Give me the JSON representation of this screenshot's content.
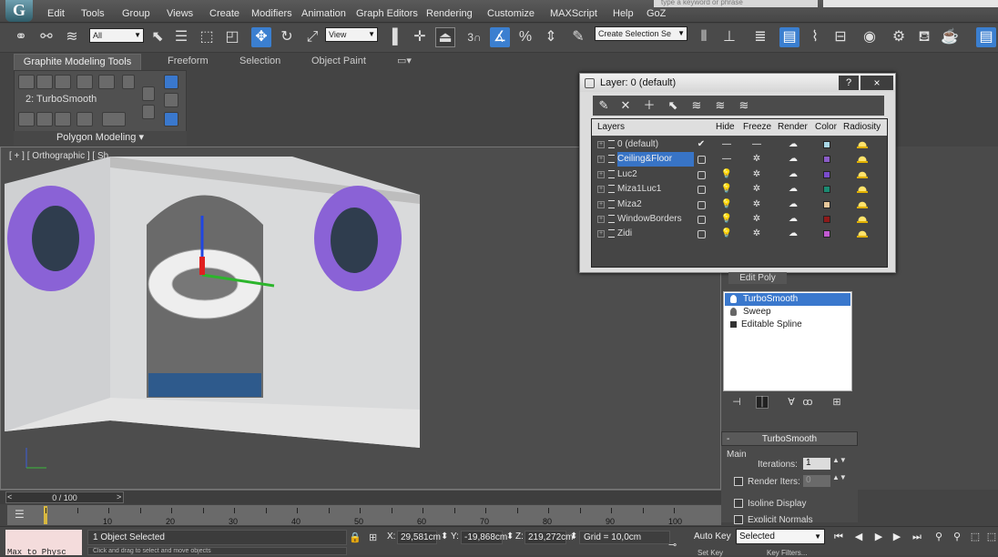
{
  "app": {
    "logo": "G"
  },
  "menu": [
    "Edit",
    "Tools",
    "Group",
    "Views",
    "Create",
    "Modifiers",
    "Animation",
    "Graph Editors",
    "Rendering",
    "Customize",
    "MAXScript",
    "Help",
    "GoZ"
  ],
  "search_placeholder": "type a keyword or phrase",
  "toolbar": {
    "filter_value": "All",
    "view_value": "View",
    "snap_label": "3",
    "named_selection_placeholder": "Create Selection Se"
  },
  "ribbon": {
    "tabs": [
      "Graphite Modeling Tools",
      "Freeform",
      "Selection",
      "Object Paint"
    ],
    "level_label": "2: TurboSmooth",
    "footer_label": "Polygon Modeling"
  },
  "viewport": {
    "label": "[ + ] [ Orthographic ] [ Sh"
  },
  "layer_dialog": {
    "title": "Layer: 0 (default)",
    "help": "?",
    "close": "×",
    "columns": [
      "Layers",
      "Hide",
      "Freeze",
      "Render",
      "Color",
      "Radiosity"
    ],
    "layers": [
      {
        "name": "0 (default)",
        "current": true,
        "hide": "—",
        "freeze": "—",
        "render": "☁",
        "color": "#a9d7e6"
      },
      {
        "name": "Ceiling&Floor",
        "current": false,
        "hide": "—",
        "freeze": "✲",
        "render": "☁",
        "color": "#8a5cc8"
      },
      {
        "name": "Luc2",
        "current": false,
        "hide": "💡",
        "freeze": "✲",
        "render": "☁",
        "color": "#7a4ccd"
      },
      {
        "name": "Miza1Luc1",
        "current": false,
        "hide": "💡",
        "freeze": "✲",
        "render": "☁",
        "color": "#1b8a72"
      },
      {
        "name": "Miza2",
        "current": false,
        "hide": "💡",
        "freeze": "✲",
        "render": "☁",
        "color": "#e6c79b"
      },
      {
        "name": "WindowBorders",
        "current": false,
        "hide": "💡",
        "freeze": "✲",
        "render": "☁",
        "color": "#8e1a1a"
      },
      {
        "name": "Zidi",
        "current": false,
        "hide": "💡",
        "freeze": "✲",
        "render": "☁",
        "color": "#c25ad2"
      }
    ],
    "selected_index": 1
  },
  "modifier_stack": {
    "above_label": "Edit Poly",
    "items": [
      {
        "name": "TurboSmooth",
        "selected": true,
        "icon": "bulb"
      },
      {
        "name": "Sweep",
        "selected": false,
        "icon": "bulb"
      },
      {
        "name": "Editable Spline",
        "selected": false,
        "icon": "box"
      }
    ]
  },
  "turbosmooth": {
    "header": "TurboSmooth",
    "collapse": "-",
    "group": "Main",
    "iterations_label": "Iterations:",
    "iterations_value": "1",
    "render_iters_label": "Render Iters:",
    "render_iters_value": "0",
    "isoline_label": "Isoline Display",
    "explicit_label": "Explicit Normals"
  },
  "timeline": {
    "slider_label": "0 / 100",
    "ticks": [
      "10",
      "20",
      "30",
      "40",
      "50",
      "60",
      "70",
      "80",
      "90",
      "100"
    ]
  },
  "status": {
    "maxscript": "Max to Physc",
    "selection_text": "1 Object Selected",
    "prompt_text": "Click and drag to select and move objects",
    "x_label": "X:",
    "x_value": "29,581cm",
    "y_label": "Y:",
    "y_value": "-19,868cm",
    "z_label": "Z:",
    "z_value": "219,272cm",
    "grid": "Grid = 10,0cm",
    "auto_key": "Auto Key",
    "set_key": "Set Key",
    "key_mode": "Selected",
    "key_filters": "Key Filters..."
  },
  "colors": {
    "accent": "#3a78cd",
    "torus": "#8a62d6"
  }
}
